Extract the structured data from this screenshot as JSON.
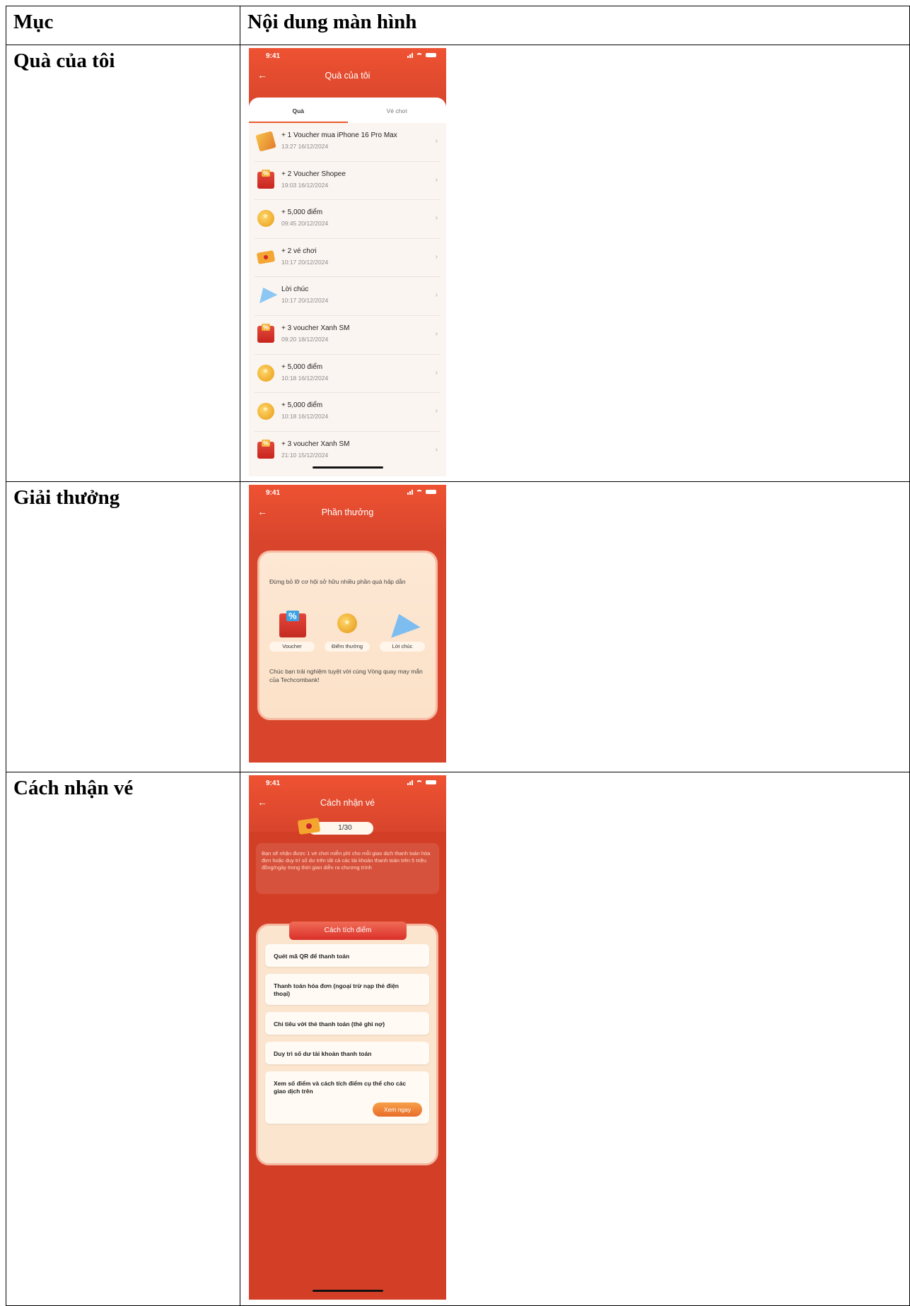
{
  "table": {
    "header": {
      "col1": "Mục",
      "col2": "Nội dung màn hình"
    },
    "rows": [
      {
        "label": "Quà của tôi"
      },
      {
        "label": "Giải thưởng"
      },
      {
        "label": "Cách nhận vé"
      }
    ]
  },
  "status_time": "9:41",
  "screen1": {
    "title": "Quà của tôi",
    "tabs": [
      "Quà",
      "Vé chơi"
    ],
    "active_tab": "Quà",
    "items": [
      {
        "title": "+ 1 Voucher mua iPhone 16 Pro Max",
        "time": "13:27 16/12/2024",
        "icon": "voucher-icon"
      },
      {
        "title": "+ 2 Voucher Shopee",
        "time": "19:03 16/12/2024",
        "icon": "gift-box-icon"
      },
      {
        "title": "+ 5,000 điểm",
        "time": "09:45 20/12/2024",
        "icon": "coin-icon"
      },
      {
        "title": "+ 2 vé chơi",
        "time": "10:17 20/12/2024",
        "icon": "ticket-icon"
      },
      {
        "title": "Lời chúc",
        "time": "10:17 20/12/2024",
        "icon": "paper-plane-icon"
      },
      {
        "title": "+ 3 voucher Xanh SM",
        "time": "09:20 18/12/2024",
        "icon": "gift-box-icon"
      },
      {
        "title": "+ 5,000 điểm",
        "time": "10:18 16/12/2024",
        "icon": "coin-icon"
      },
      {
        "title": "+ 5,000 điểm",
        "time": "10:18 16/12/2024",
        "icon": "coin-icon"
      },
      {
        "title": "+ 3 voucher Xanh SM",
        "time": "21:10 15/12/2024",
        "icon": "gift-box-icon"
      }
    ]
  },
  "screen2": {
    "title": "Phần thưởng",
    "intro": "Đừng bỏ lỡ cơ hội sở hữu nhiều phần quà hấp dẫn",
    "rewards": [
      {
        "label": "Voucher",
        "icon": "voucher-gift-icon"
      },
      {
        "label": "Điểm thưởng",
        "icon": "coins-icon"
      },
      {
        "label": "Lời chúc",
        "icon": "paper-plane-icon"
      }
    ],
    "outro": "Chúc bạn trải nghiệm tuyệt vời cùng Vòng quay may mắn của Techcombank!"
  },
  "screen3": {
    "title": "Cách nhận vé",
    "ticket_count": "1/30",
    "info": "Bạn sẽ nhận được 1 vé chơi miễn phí cho mỗi giao dịch thanh toán hóa đơn hoặc duy trì số dư trên tất cả các tài khoản thanh toán trên 5 triệu đồng/ngày trong thời gian diễn ra chương trình",
    "section_title": "Cách tích điểm",
    "methods": [
      "Quét mã QR để thanh toán",
      "Thanh toán hóa đơn (ngoại trừ nạp thẻ điện thoại)",
      "Chi tiêu với thẻ thanh toán (thẻ ghi nợ)",
      "Duy trì số dư tài khoản thanh toán",
      "Xem số điểm và cách tích điểm cụ thể cho các giao dịch trên"
    ],
    "cta": "Xem ngay"
  },
  "colors": {
    "brand_red": "#d8452c",
    "accent_orange": "#ea5b2d"
  }
}
